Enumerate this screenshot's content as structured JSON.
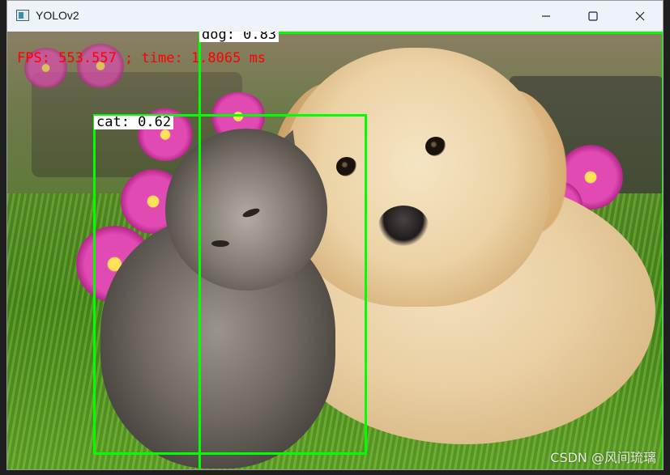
{
  "window": {
    "title": "YOLOv2",
    "app_icon": "window-app-icon",
    "controls": {
      "minimize_icon": "minimize-icon",
      "maximize_icon": "maximize-icon",
      "close_icon": "close-icon"
    }
  },
  "overlay": {
    "fps_text": "FPS: 553.557 ; time: 1.8065 ms",
    "text_color": "#ff0000",
    "box_color": "#00ff00"
  },
  "detections": [
    {
      "label": "dog: 0.83",
      "class": "dog",
      "confidence": 0.83
    },
    {
      "label": "cat: 0.62",
      "class": "cat",
      "confidence": 0.62
    }
  ],
  "watermark": "CSDN @风间琉璃"
}
